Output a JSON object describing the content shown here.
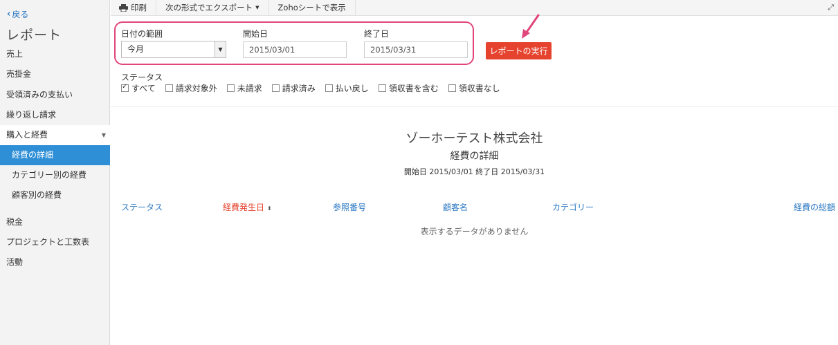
{
  "sidebar": {
    "back_label": "戻る",
    "title": "レポート",
    "items": [
      {
        "label": "売上"
      },
      {
        "label": "売掛金"
      },
      {
        "label": "受領済みの支払い"
      },
      {
        "label": "繰り返し請求"
      },
      {
        "label": "購入と経費"
      },
      {
        "label": "経費の詳細"
      },
      {
        "label": "カテゴリー別の経費"
      },
      {
        "label": "顧客別の経費"
      },
      {
        "label": "税金"
      },
      {
        "label": "プロジェクトと工数表"
      },
      {
        "label": "活動"
      }
    ]
  },
  "toolbar": {
    "print_label": "印刷",
    "export_label": "次の形式でエクスポート",
    "zoho_label": "Zohoシートで表示"
  },
  "filters": {
    "date_range_label": "日付の範囲",
    "date_range_value": "今月",
    "start_label": "開始日",
    "start_value": "2015/03/01",
    "end_label": "終了日",
    "end_value": "2015/03/31",
    "run_label": "レポートの実行"
  },
  "status": {
    "title": "ステータス",
    "options": [
      {
        "label": "すべて"
      },
      {
        "label": "請求対象外"
      },
      {
        "label": "未請求"
      },
      {
        "label": "請求済み"
      },
      {
        "label": "払い戻し"
      },
      {
        "label": "領収書を含む"
      },
      {
        "label": "領収書なし"
      }
    ]
  },
  "report": {
    "company": "ゾーホーテスト株式会社",
    "title": "経費の詳細",
    "range": "開始日 2015/03/01 終了日 2015/03/31",
    "columns": [
      {
        "label": "ステータス"
      },
      {
        "label": "経費発生日"
      },
      {
        "label": "参照番号"
      },
      {
        "label": "顧客名"
      },
      {
        "label": "カテゴリー"
      },
      {
        "label": "経費の総額"
      }
    ],
    "empty_message": "表示するデータがありません"
  },
  "colors": {
    "accent_blue": "#2e8fd6",
    "run_button": "#e6432e",
    "highlight_border": "#e0457b"
  }
}
